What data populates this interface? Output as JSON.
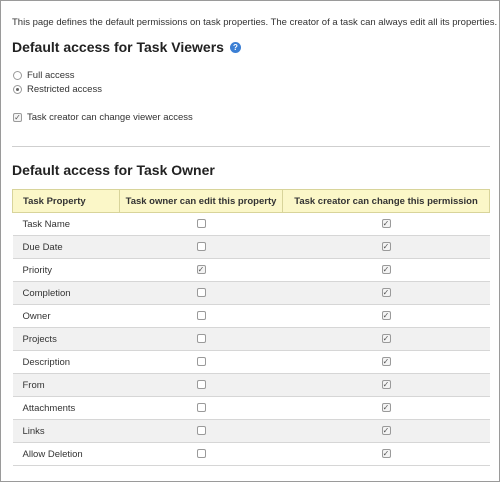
{
  "intro_text": "This page defines the default permissions on task properties. The creator of a task can always edit all its properties.",
  "viewers": {
    "heading": "Default access for Task Viewers",
    "help_glyph": "?",
    "options": [
      {
        "label": "Full access",
        "selected": false
      },
      {
        "label": "Restricted access",
        "selected": true
      }
    ],
    "creator_change": {
      "label": "Task creator can change viewer access",
      "checked": true
    }
  },
  "owner": {
    "heading": "Default access for Task Owner",
    "columns": [
      "Task Property",
      "Task owner can edit this property",
      "Task creator can change this permission"
    ],
    "rows": [
      {
        "property": "Task Name",
        "owner_can_edit": false,
        "creator_can_change": true
      },
      {
        "property": "Due Date",
        "owner_can_edit": false,
        "creator_can_change": true
      },
      {
        "property": "Priority",
        "owner_can_edit": true,
        "creator_can_change": true
      },
      {
        "property": "Completion",
        "owner_can_edit": false,
        "creator_can_change": true
      },
      {
        "property": "Owner",
        "owner_can_edit": false,
        "creator_can_change": true
      },
      {
        "property": "Projects",
        "owner_can_edit": false,
        "creator_can_change": true
      },
      {
        "property": "Description",
        "owner_can_edit": false,
        "creator_can_change": true
      },
      {
        "property": "From",
        "owner_can_edit": false,
        "creator_can_change": true
      },
      {
        "property": "Attachments",
        "owner_can_edit": false,
        "creator_can_change": true
      },
      {
        "property": "Links",
        "owner_can_edit": false,
        "creator_can_change": true
      },
      {
        "property": "Allow Deletion",
        "owner_can_edit": false,
        "creator_can_change": true
      }
    ]
  },
  "colors": {
    "header_bg": "#fbf7c8",
    "alt_row_bg": "#f1f1f1",
    "help_icon": "#3b7fd4"
  }
}
